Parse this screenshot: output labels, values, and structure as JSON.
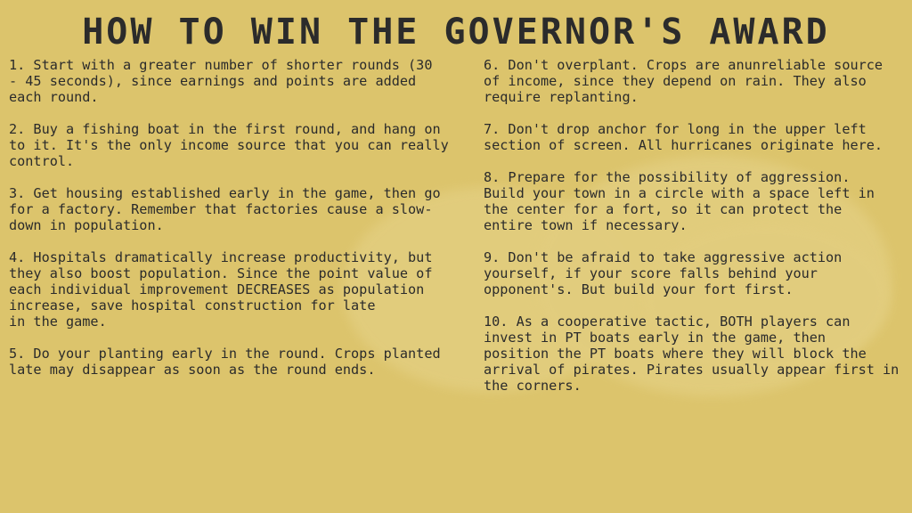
{
  "title": "HOW TO WIN THE GOVERNOR'S AWARD",
  "tips_left": [
    "1. Start with a greater number of shorter rounds (30\n- 45 seconds), since earnings and points are added\neach round.",
    "2. Buy a fishing boat in the first round, and hang on\nto it. It's the only income source that you can really\ncontrol.",
    "3. Get housing established early in the game, then go\nfor a factory. Remember that factories cause a slow-\ndown in population.",
    "4. Hospitals dramatically increase productivity, but\nthey also boost population. Since the point value of\neach individual improvement DECREASES as population\nincrease, save hospital construction for late\nin the game.",
    "5. Do your planting early in the round. Crops planted\nlate may disappear as soon as the round ends."
  ],
  "tips_right": [
    "6. Don't overplant. Crops are anunreliable source\nof income, since they depend on rain. They also\nrequire replanting.",
    "7. Don't drop anchor for long in the upper left\nsection of screen. All hurricanes originate here.",
    "8. Prepare for the possibility of aggression.\nBuild your town in a circle with a space left in\nthe center for a fort, so it can protect the\nentire town if necessary.",
    "9. Don't be afraid to take aggressive action\nyourself, if your score falls behind your\nopponent's. But build your fort first.",
    "10. As a cooperative tactic, BOTH players can\ninvest in PT boats early in the game, then\nposition the PT boats where they will block the\narrival of pirates. Pirates usually appear first in\nthe corners."
  ]
}
